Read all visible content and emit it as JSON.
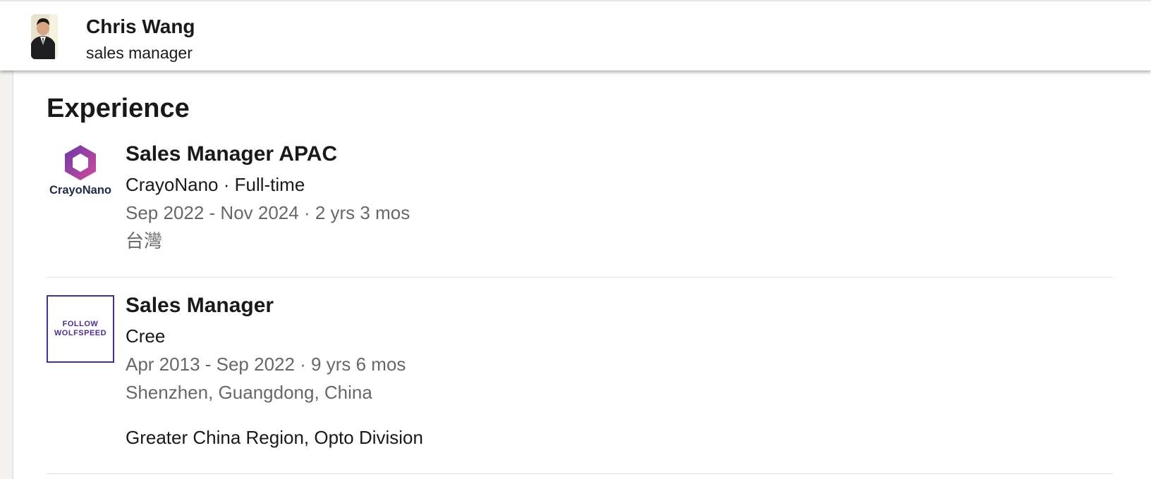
{
  "header": {
    "name": "Chris Wang",
    "title": "sales manager"
  },
  "section": {
    "title": "Experience"
  },
  "experiences": [
    {
      "title": "Sales Manager APAC",
      "company_line": "CrayoNano · Full-time",
      "dates": "Sep 2022 - Nov 2024 · 2 yrs 3 mos",
      "location": "台灣",
      "logo_text": "CrayoNano"
    },
    {
      "title": "Sales Manager",
      "company_line": "Cree",
      "dates": "Apr 2013 - Sep 2022 · 9 yrs 6 mos",
      "location": "Shenzhen, Guangdong, China",
      "description": "Greater China Region, Opto Division",
      "logo_text_1": "FOLLOW",
      "logo_text_2": "WOLFSPEED"
    }
  ],
  "colors": {
    "crayonano_logo_start": "#6a3aa8",
    "crayonano_logo_end": "#d14a9c",
    "wolfspeed_logo": "#4a2f86"
  },
  "icons": {
    "avatar": "profile-photo",
    "crayonano": "crayonano-hexagon-logo",
    "wolfspeed": "wolfspeed-logo"
  }
}
